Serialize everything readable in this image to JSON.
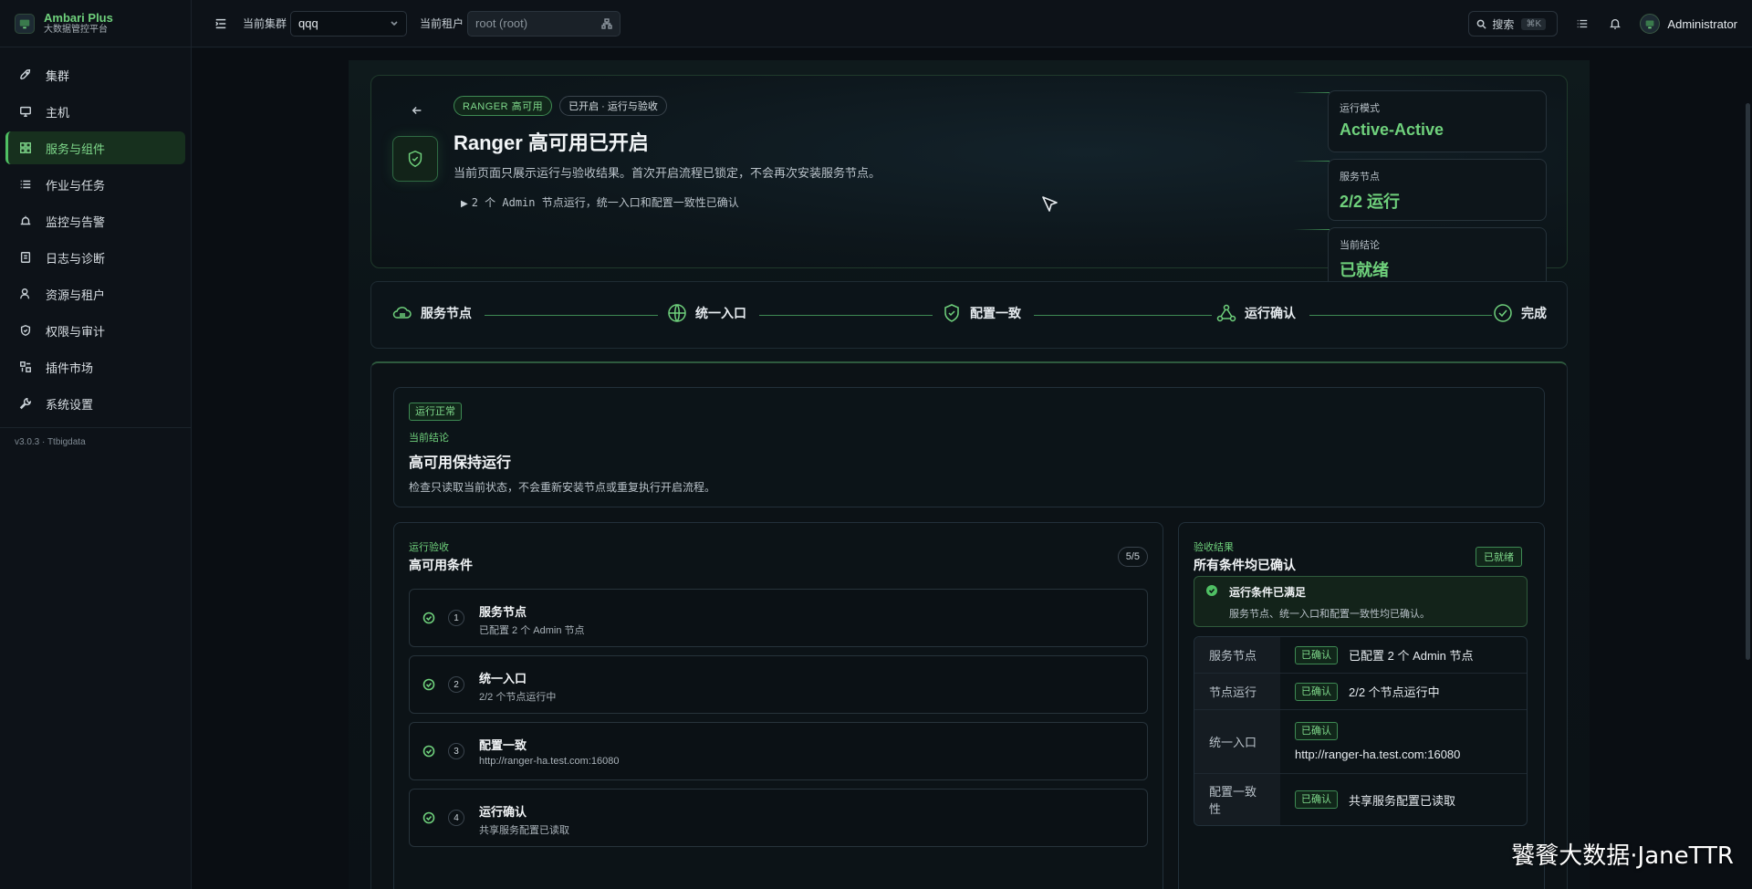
{
  "brand": {
    "name": "Ambari Plus",
    "subtitle": "大数据管控平台"
  },
  "sidebar": {
    "items": [
      {
        "label": "集群",
        "icon": "rocket-icon",
        "active": false
      },
      {
        "label": "主机",
        "icon": "monitor-icon",
        "active": false
      },
      {
        "label": "服务与组件",
        "icon": "grid-icon",
        "active": true
      },
      {
        "label": "作业与任务",
        "icon": "list-icon",
        "active": false
      },
      {
        "label": "监控与告警",
        "icon": "alarm-icon",
        "active": false
      },
      {
        "label": "日志与诊断",
        "icon": "log-icon",
        "active": false
      },
      {
        "label": "资源与租户",
        "icon": "users-icon",
        "active": false
      },
      {
        "label": "权限与审计",
        "icon": "shield-icon",
        "active": false
      },
      {
        "label": "插件市场",
        "icon": "plugin-icon",
        "active": false
      },
      {
        "label": "系统设置",
        "icon": "wrench-icon",
        "active": false
      }
    ],
    "version": "v3.0.3 · Ttbigdata"
  },
  "topbar": {
    "cluster_label": "当前集群",
    "cluster_value": "qqq",
    "tenant_label": "当前租户",
    "tenant_placeholder": "root (root)",
    "search_label": "搜索",
    "search_shortcut": "⌘K",
    "user_name": "Administrator"
  },
  "hero": {
    "tag_primary": "RANGER 高可用",
    "tag_secondary": "已开启 · 运行与验收",
    "title": "Ranger 高可用已开启",
    "description": "当前页面只展示运行与验收结果。首次开启流程已锁定，不会再次安装服务节点。",
    "detail": "2 个 Admin 节点运行，统一入口和配置一致性已确认",
    "stats": [
      {
        "label": "运行模式",
        "value": "Active-Active"
      },
      {
        "label": "服务节点",
        "value": "2/2 运行"
      },
      {
        "label": "当前结论",
        "value": "已就绪"
      }
    ]
  },
  "steps": [
    {
      "label": "服务节点",
      "icon": "cloud-icon"
    },
    {
      "label": "统一入口",
      "icon": "globe-icon"
    },
    {
      "label": "配置一致",
      "icon": "shield-check-icon"
    },
    {
      "label": "运行确认",
      "icon": "nodes-icon"
    },
    {
      "label": "完成",
      "icon": "check-circle-icon"
    }
  ],
  "summary": {
    "badge": "运行正常",
    "label": "当前结论",
    "title": "高可用保持运行",
    "description": "检查只读取当前状态，不会重新安装节点或重复执行开启流程。"
  },
  "conditions": {
    "label": "运行验收",
    "title": "高可用条件",
    "count": "5/5",
    "items": [
      {
        "num": "1",
        "title": "服务节点",
        "sub": "已配置 2 个 Admin 节点"
      },
      {
        "num": "2",
        "title": "统一入口",
        "sub": "2/2 个节点运行中"
      },
      {
        "num": "3",
        "title": "配置一致",
        "sub": "http://ranger-ha.test.com:16080"
      },
      {
        "num": "4",
        "title": "运行确认",
        "sub": "共享服务配置已读取"
      }
    ]
  },
  "results": {
    "label": "验收结果",
    "title": "所有条件均已确认",
    "badge": "已就绪",
    "alert_title": "运行条件已满足",
    "alert_desc": "服务节点、统一入口和配置一致性均已确认。",
    "rows": [
      {
        "key": "服务节点",
        "status": "已确认",
        "value": "已配置 2 个 Admin 节点"
      },
      {
        "key": "节点运行",
        "status": "已确认",
        "value": "2/2 个节点运行中"
      },
      {
        "key": "统一入口",
        "status": "已确认",
        "value": "http://ranger-ha.test.com:16080"
      },
      {
        "key": "配置一致性",
        "status": "已确认",
        "value": "共享服务配置已读取"
      }
    ]
  },
  "watermark": "饕餮大数据·JaneTTR",
  "colors": {
    "accent": "#6fd17c",
    "background": "#0b1016",
    "border_green": "#3e8a53"
  }
}
